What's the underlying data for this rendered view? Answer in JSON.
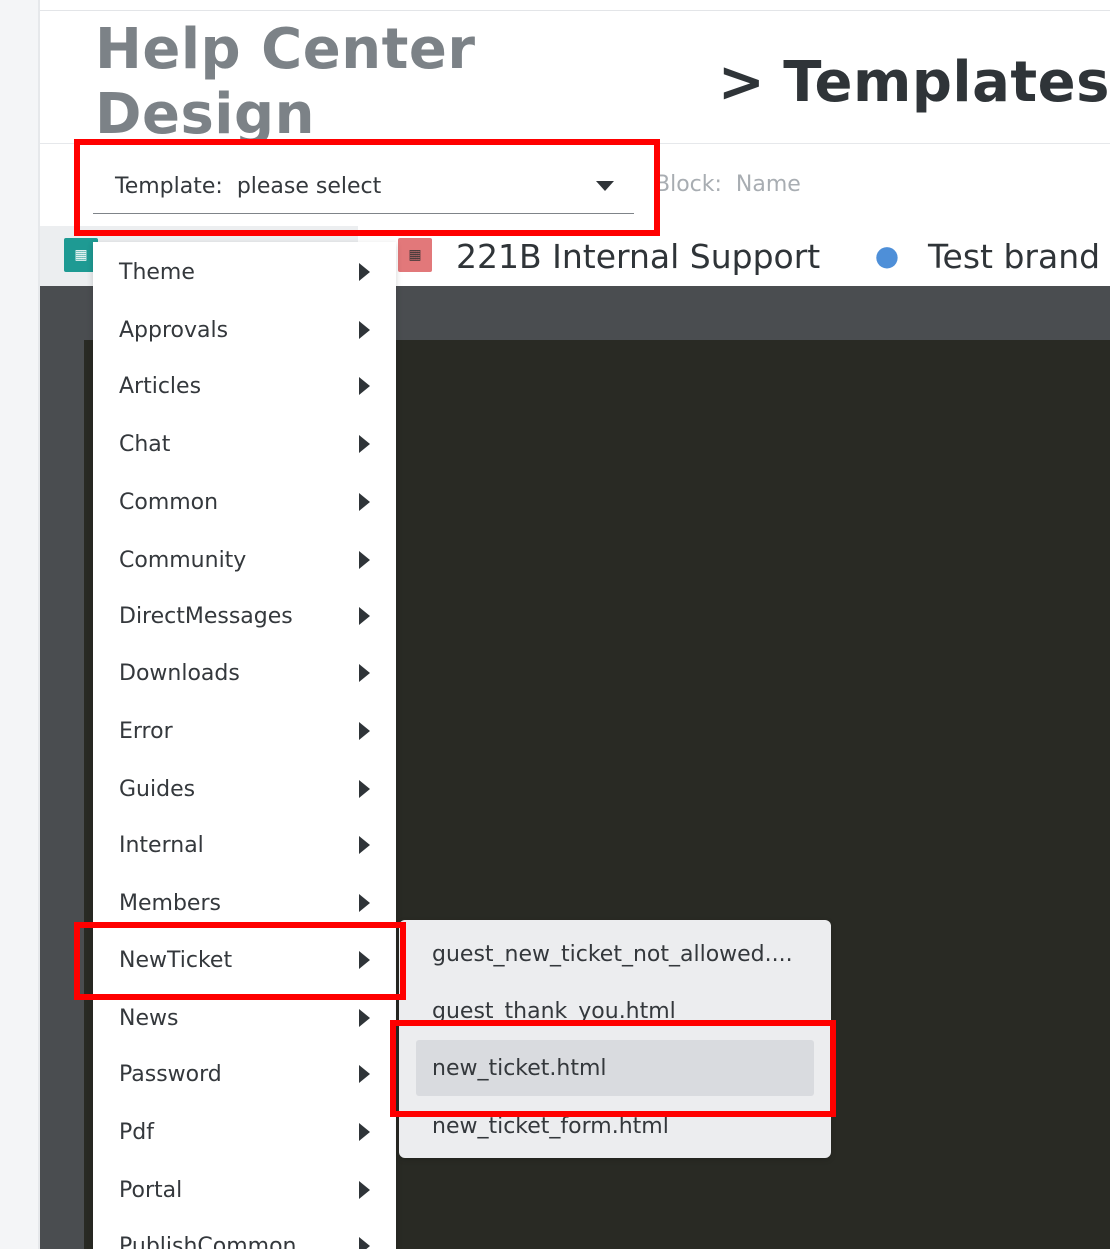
{
  "header": {
    "parent": "Help Center Design",
    "separator": ">",
    "current": "Templates"
  },
  "template_select": {
    "label": "Template:",
    "value": "please select"
  },
  "block_select": {
    "label": "Block:",
    "value": "Name"
  },
  "brands": [
    {
      "name": "",
      "logo_icon": "brand-logo-icon"
    },
    {
      "name": "221B Internal Support",
      "logo_icon": "brand-logo-icon"
    },
    {
      "name": "Test brand",
      "logo_icon": "elephant-icon"
    }
  ],
  "menu": {
    "items": [
      {
        "label": "Theme"
      },
      {
        "label": "Approvals"
      },
      {
        "label": "Articles"
      },
      {
        "label": "Chat"
      },
      {
        "label": "Common"
      },
      {
        "label": "Community"
      },
      {
        "label": "DirectMessages"
      },
      {
        "label": "Downloads"
      },
      {
        "label": "Error"
      },
      {
        "label": "Guides"
      },
      {
        "label": "Internal"
      },
      {
        "label": "Members"
      },
      {
        "label": "NewTicket"
      },
      {
        "label": "News"
      },
      {
        "label": "Password"
      },
      {
        "label": "Pdf"
      },
      {
        "label": "Portal"
      },
      {
        "label": "PublishCommon"
      }
    ]
  },
  "submenu": {
    "items": [
      {
        "label": "guest_new_ticket_not_allowed...."
      },
      {
        "label": "guest_thank_you.html"
      },
      {
        "label": "new_ticket.html"
      },
      {
        "label": "new_ticket_form.html"
      }
    ]
  },
  "colors": {
    "annotation": "#ff0000",
    "preview_bg": "#292a24",
    "menu_bg": "#ffffff",
    "submenu_bg": "#ecedef"
  }
}
